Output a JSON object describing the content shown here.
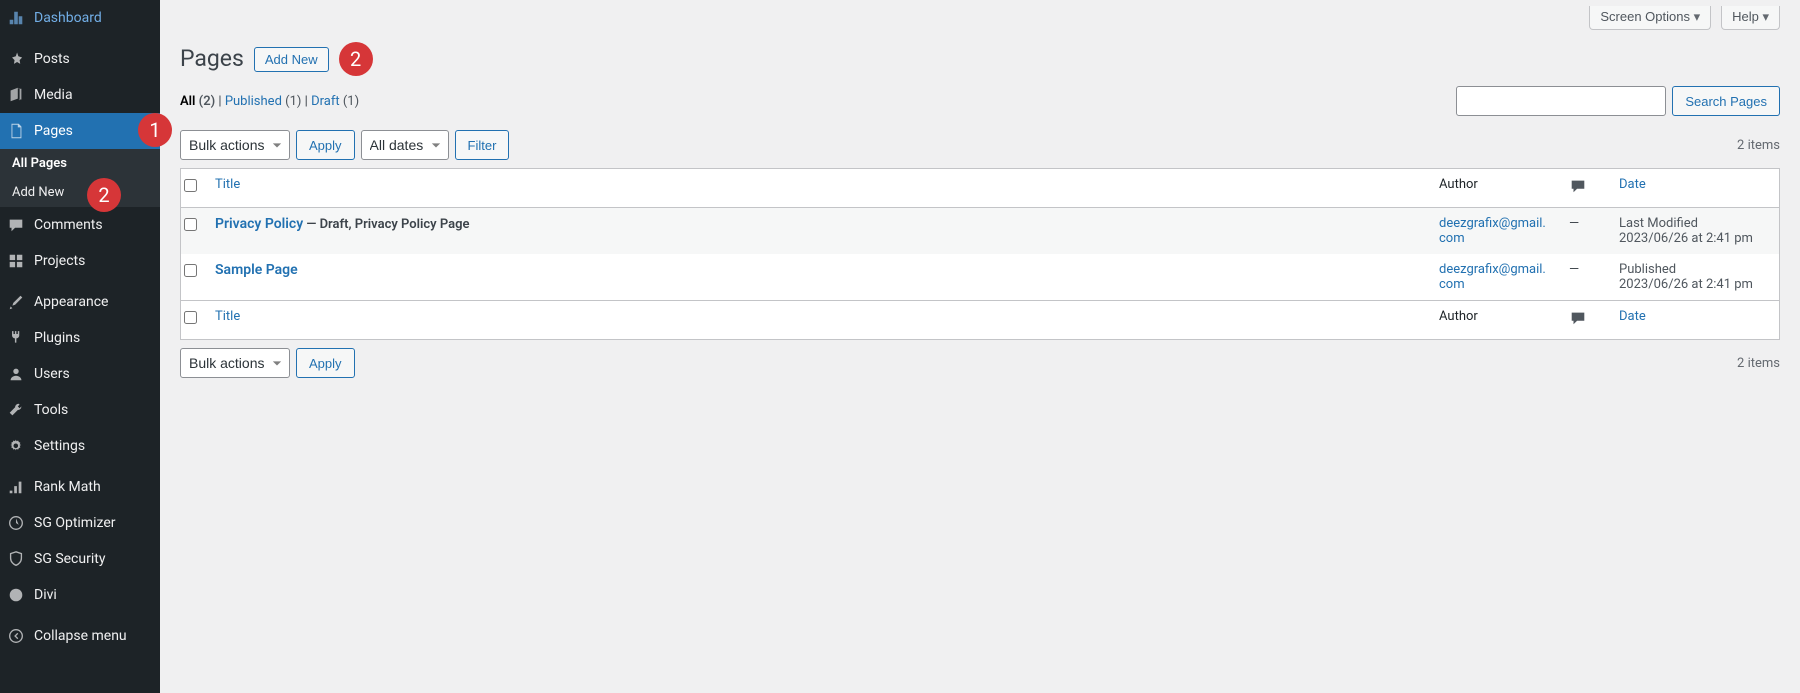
{
  "sidebar": {
    "items": [
      {
        "label": "Dashboard",
        "icon": "dashboard"
      },
      {
        "label": "Posts",
        "icon": "pin"
      },
      {
        "label": "Media",
        "icon": "media"
      },
      {
        "label": "Pages",
        "icon": "pages"
      },
      {
        "label": "Comments",
        "icon": "comments"
      },
      {
        "label": "Projects",
        "icon": "projects"
      },
      {
        "label": "Appearance",
        "icon": "brush"
      },
      {
        "label": "Plugins",
        "icon": "plug"
      },
      {
        "label": "Users",
        "icon": "users"
      },
      {
        "label": "Tools",
        "icon": "tools"
      },
      {
        "label": "Settings",
        "icon": "settings"
      },
      {
        "label": "Rank Math",
        "icon": "rankmath"
      },
      {
        "label": "SG Optimizer",
        "icon": "sgopt"
      },
      {
        "label": "SG Security",
        "icon": "sgsec"
      },
      {
        "label": "Divi",
        "icon": "divi"
      },
      {
        "label": "Collapse menu",
        "icon": "collapse"
      }
    ],
    "submenu": [
      {
        "label": "All Pages"
      },
      {
        "label": "Add New"
      }
    ]
  },
  "badges": {
    "pages_badge": "1",
    "addnew_sub_badge": "2",
    "addnew_header_badge": "2"
  },
  "top": {
    "screen_options": "Screen Options",
    "help": "Help"
  },
  "header": {
    "title": "Pages",
    "add_new": "Add New"
  },
  "filters": {
    "all_label": "All",
    "all_count": "(2)",
    "sep1": " | ",
    "published_label": "Published",
    "published_count": "(1)",
    "sep2": " | ",
    "draft_label": "Draft",
    "draft_count": "(1)"
  },
  "search": {
    "button": "Search Pages"
  },
  "tablenav": {
    "bulk_actions": "Bulk actions",
    "apply": "Apply",
    "all_dates": "All dates",
    "filter": "Filter",
    "count": "2 items"
  },
  "table": {
    "headers": {
      "title": "Title",
      "author": "Author",
      "date": "Date"
    },
    "rows": [
      {
        "title": "Privacy Policy",
        "state": " — Draft, Privacy Policy Page",
        "author": "deezgrafix@gmail.com",
        "comments_aria": "—",
        "date_status": "Last Modified",
        "date_value": "2023/06/26 at 2:41 pm"
      },
      {
        "title": "Sample Page",
        "state": "",
        "author": "deezgrafix@gmail.com",
        "comments_aria": "—",
        "date_status": "Published",
        "date_value": "2023/06/26 at 2:41 pm"
      }
    ]
  }
}
